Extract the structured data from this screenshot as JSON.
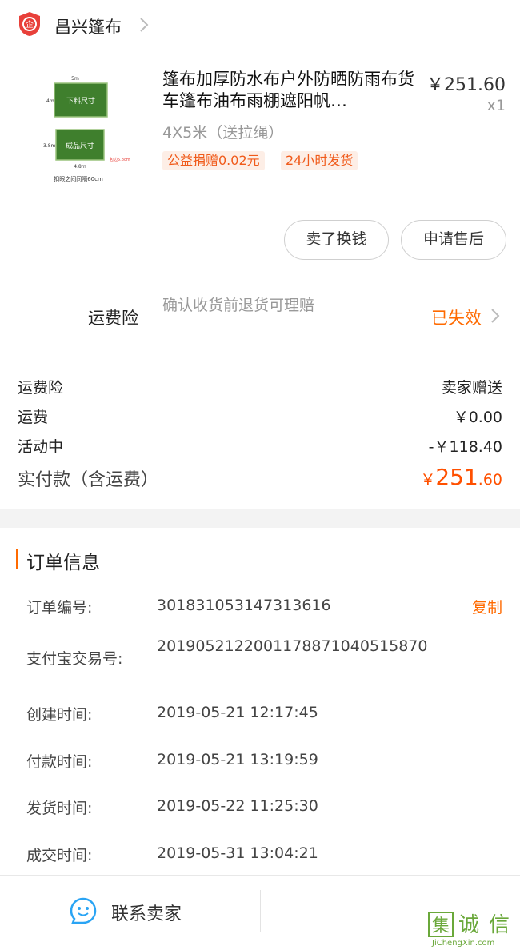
{
  "shop": {
    "name": "昌兴篷布",
    "logo_icon": "shop-badge-icon",
    "brand_color": "#e8403a"
  },
  "product": {
    "title": "篷布加厚防水布户外防晒防雨布货车篷布油布雨棚遮阳帆…",
    "price": "￥251.60",
    "qty": "x1",
    "sku": "4X5米（送拉绳）",
    "thumb": {
      "top_width": "5m",
      "top_height": "4m",
      "top_label": "下料尺寸",
      "bottom_height": "3.8m",
      "bottom_label": "成品尺寸",
      "bottom_width": "4.8m",
      "side_note": "包边5.8cm",
      "footer_note": "扣眼之间间隔60cm"
    },
    "tags": [
      "公益捐赠0.02元",
      "24小时发货"
    ]
  },
  "actions": {
    "sell_label": "卖了换钱",
    "after_sale_label": "申请售后"
  },
  "insurance": {
    "label": "运费险",
    "description": "确认收货前退货可理赔",
    "status": "已失效"
  },
  "summary": {
    "rows": [
      {
        "label": "运费险",
        "value": "卖家赠送"
      },
      {
        "label": "运费",
        "value": "￥0.00"
      },
      {
        "label": "活动中",
        "value": "-￥118.40"
      }
    ],
    "total_label": "实付款（含运费）",
    "total_currency": "￥",
    "total_integer": "251",
    "total_decimal": ".60"
  },
  "order_info": {
    "title": "订单信息",
    "copy_label": "复制",
    "rows": [
      {
        "label": "订单编号:",
        "value": "301831053147313616"
      },
      {
        "label": "支付宝交易号:",
        "value": "2019052122001178871040515870"
      },
      {
        "label": "创建时间:",
        "value": "2019-05-21 12:17:45"
      },
      {
        "label": "付款时间:",
        "value": "2019-05-21 13:19:59"
      },
      {
        "label": "发货时间:",
        "value": "2019-05-22 11:25:30"
      },
      {
        "label": "成交时间:",
        "value": "2019-05-31 13:04:21"
      }
    ]
  },
  "bottom": {
    "contact_label": "联系卖家",
    "contact_icon": "smile-chat-icon"
  },
  "watermark": {
    "text": "集诚信",
    "url_text": "JiChengXin.com"
  },
  "colors": {
    "accent": "#ff6a00",
    "tag_bg": "#fdeee6",
    "green": "#3f7f2d"
  }
}
